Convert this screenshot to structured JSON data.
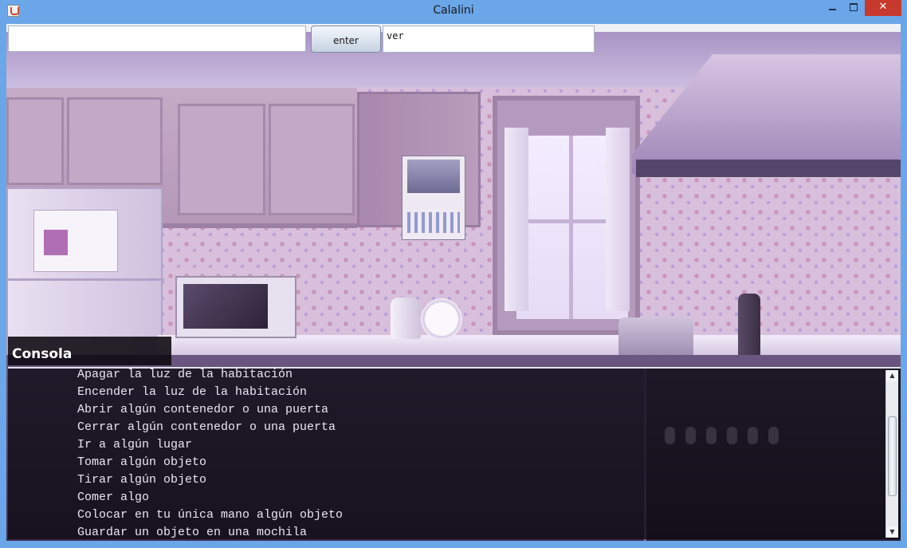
{
  "window": {
    "title": "Calalini",
    "minimize_glyph": "",
    "maximize_glyph": "",
    "close_glyph": "✕",
    "icon": "java-cup-icon"
  },
  "toolbar": {
    "command_value": "",
    "enter_label": "enter",
    "last_command": "ver"
  },
  "console": {
    "label": "Consola",
    "lines": [
      "Apagar la luz de la habitación",
      "Encender la luz de la habitación",
      "Abrir algún contenedor o una puerta",
      "Cerrar algún contenedor o una puerta",
      "Ir a algún lugar",
      "Tomar algún objeto",
      "Tirar algún objeto",
      "Comer algo",
      "Colocar en tu única mano algún objeto",
      "Guardar un objeto en una mochila"
    ],
    "scroll_up_glyph": "▲",
    "scroll_down_glyph": "▼"
  },
  "colors": {
    "titlebar": "#6ba6e8",
    "close_button": "#c7392c",
    "console_background": "#0c0a12"
  }
}
